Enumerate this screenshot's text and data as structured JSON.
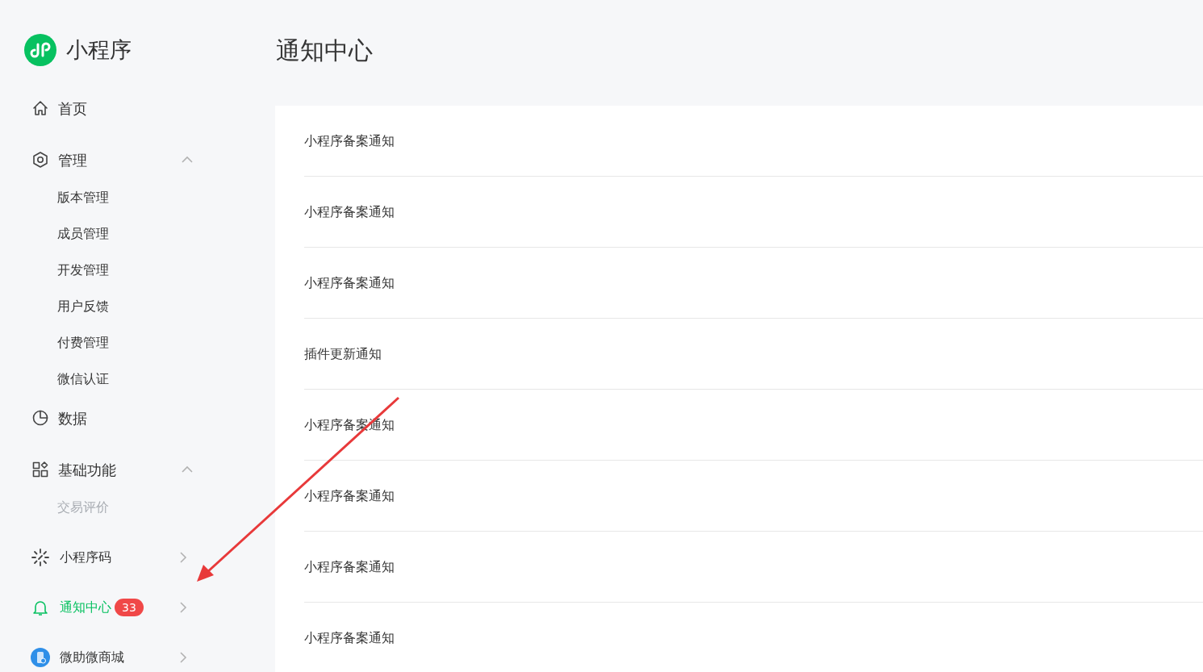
{
  "sidebar": {
    "logo_text": "小程序",
    "items": [
      {
        "kind": "nav",
        "label": "首页"
      },
      {
        "kind": "nav",
        "label": "管理",
        "expanded": true,
        "children": [
          {
            "label": "版本管理",
            "disabled": false
          },
          {
            "label": "成员管理",
            "disabled": false
          },
          {
            "label": "开发管理",
            "disabled": false
          },
          {
            "label": "用户反馈",
            "disabled": false
          },
          {
            "label": "付费管理",
            "disabled": false
          },
          {
            "label": "微信认证",
            "disabled": false
          }
        ]
      },
      {
        "kind": "nav",
        "label": "数据"
      },
      {
        "kind": "nav",
        "label": "基础功能",
        "expanded": true,
        "children": [
          {
            "label": "交易评价",
            "disabled": true
          }
        ]
      },
      {
        "kind": "entry",
        "label": "小程序码",
        "expanded": false,
        "selected": false
      },
      {
        "kind": "entry",
        "label": "通知中心",
        "badge": "33",
        "expanded": false,
        "selected": true
      },
      {
        "kind": "entry",
        "label": "微助微商城",
        "expanded": false,
        "selected": false
      }
    ]
  },
  "page": {
    "title": "通知中心",
    "notifications": [
      "小程序备案通知",
      "小程序备案通知",
      "小程序备案通知",
      "插件更新通知",
      "小程序备案通知",
      "小程序备案通知",
      "小程序备案通知",
      "小程序备案通知"
    ]
  }
}
